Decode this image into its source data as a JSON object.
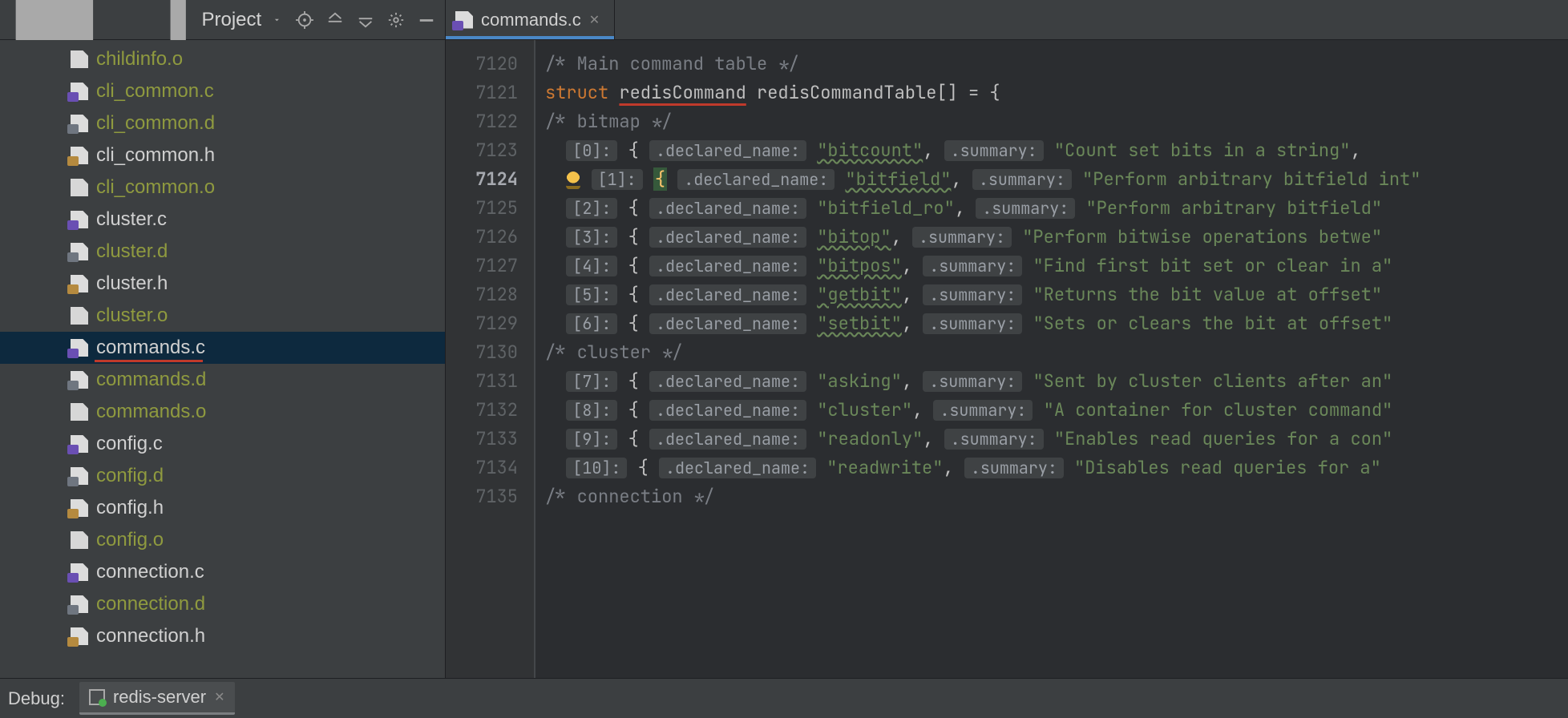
{
  "sidebar": {
    "title": "Project",
    "items": [
      {
        "label": "childinfo.o",
        "kind": "o",
        "dim": true
      },
      {
        "label": "cli_common.c",
        "kind": "c",
        "dim": true
      },
      {
        "label": "cli_common.d",
        "kind": "d",
        "dim": true
      },
      {
        "label": "cli_common.h",
        "kind": "h",
        "dim": false
      },
      {
        "label": "cli_common.o",
        "kind": "o",
        "dim": true
      },
      {
        "label": "cluster.c",
        "kind": "c",
        "dim": false
      },
      {
        "label": "cluster.d",
        "kind": "d",
        "dim": true
      },
      {
        "label": "cluster.h",
        "kind": "h",
        "dim": false
      },
      {
        "label": "cluster.o",
        "kind": "o",
        "dim": true
      },
      {
        "label": "commands.c",
        "kind": "c",
        "dim": false,
        "selected": true,
        "underline": true
      },
      {
        "label": "commands.d",
        "kind": "d",
        "dim": true
      },
      {
        "label": "commands.o",
        "kind": "o",
        "dim": true
      },
      {
        "label": "config.c",
        "kind": "c",
        "dim": false
      },
      {
        "label": "config.d",
        "kind": "d",
        "dim": true
      },
      {
        "label": "config.h",
        "kind": "h",
        "dim": false
      },
      {
        "label": "config.o",
        "kind": "o",
        "dim": true
      },
      {
        "label": "connection.c",
        "kind": "c",
        "dim": false
      },
      {
        "label": "connection.d",
        "kind": "d",
        "dim": true
      },
      {
        "label": "connection.h",
        "kind": "h",
        "dim": false
      }
    ]
  },
  "tabs": {
    "active": {
      "label": "commands.c",
      "kind": "c"
    }
  },
  "editor": {
    "first_line": 7120,
    "last_line": 7135,
    "current_line": 7124,
    "section_comments": {
      "main": "/* Main command table */",
      "bitmap": "/* bitmap */",
      "cluster": "/* cluster */",
      "connection": "/* connection */"
    },
    "struct_line": {
      "keyword": "struct",
      "typename": "redisCommand",
      "varname": "redisCommandTable",
      "rest": "[] = {"
    },
    "hint_index_label_prefix": "[",
    "hint_index_label_suffix": "]:",
    "hint_name": ".declared_name:",
    "hint_summary": ".summary:",
    "entries": [
      {
        "idx": "0",
        "name": "bitcount",
        "wavy": true,
        "summary": "Count set bits in a string",
        "trail": ","
      },
      {
        "idx": "1",
        "name": "bitfield",
        "wavy": true,
        "summary": "Perform arbitrary bitfield int",
        "trail": "",
        "bulb": true
      },
      {
        "idx": "2",
        "name": "bitfield_ro",
        "wavy": false,
        "summary": "Perform arbitrary bitfield",
        "trail": ""
      },
      {
        "idx": "3",
        "name": "bitop",
        "wavy": true,
        "summary": "Perform bitwise operations betwe",
        "trail": ""
      },
      {
        "idx": "4",
        "name": "bitpos",
        "wavy": true,
        "summary": "Find first bit set or clear in a",
        "trail": ""
      },
      {
        "idx": "5",
        "name": "getbit",
        "wavy": true,
        "summary": "Returns the bit value at offset",
        "trail": ""
      },
      {
        "idx": "6",
        "name": "setbit",
        "wavy": true,
        "summary": "Sets or clears the bit at offset",
        "trail": ""
      },
      {
        "idx": "7",
        "name": "asking",
        "wavy": false,
        "summary": "Sent by cluster clients after an",
        "trail": ""
      },
      {
        "idx": "8",
        "name": "cluster",
        "wavy": false,
        "summary": "A container for cluster command",
        "trail": ""
      },
      {
        "idx": "9",
        "name": "readonly",
        "wavy": false,
        "summary": "Enables read queries for a con",
        "trail": ""
      },
      {
        "idx": "10",
        "name": "readwrite",
        "wavy": false,
        "summary": "Disables read queries for a",
        "trail": ""
      }
    ]
  },
  "debug": {
    "label": "Debug:",
    "session": "redis-server"
  }
}
